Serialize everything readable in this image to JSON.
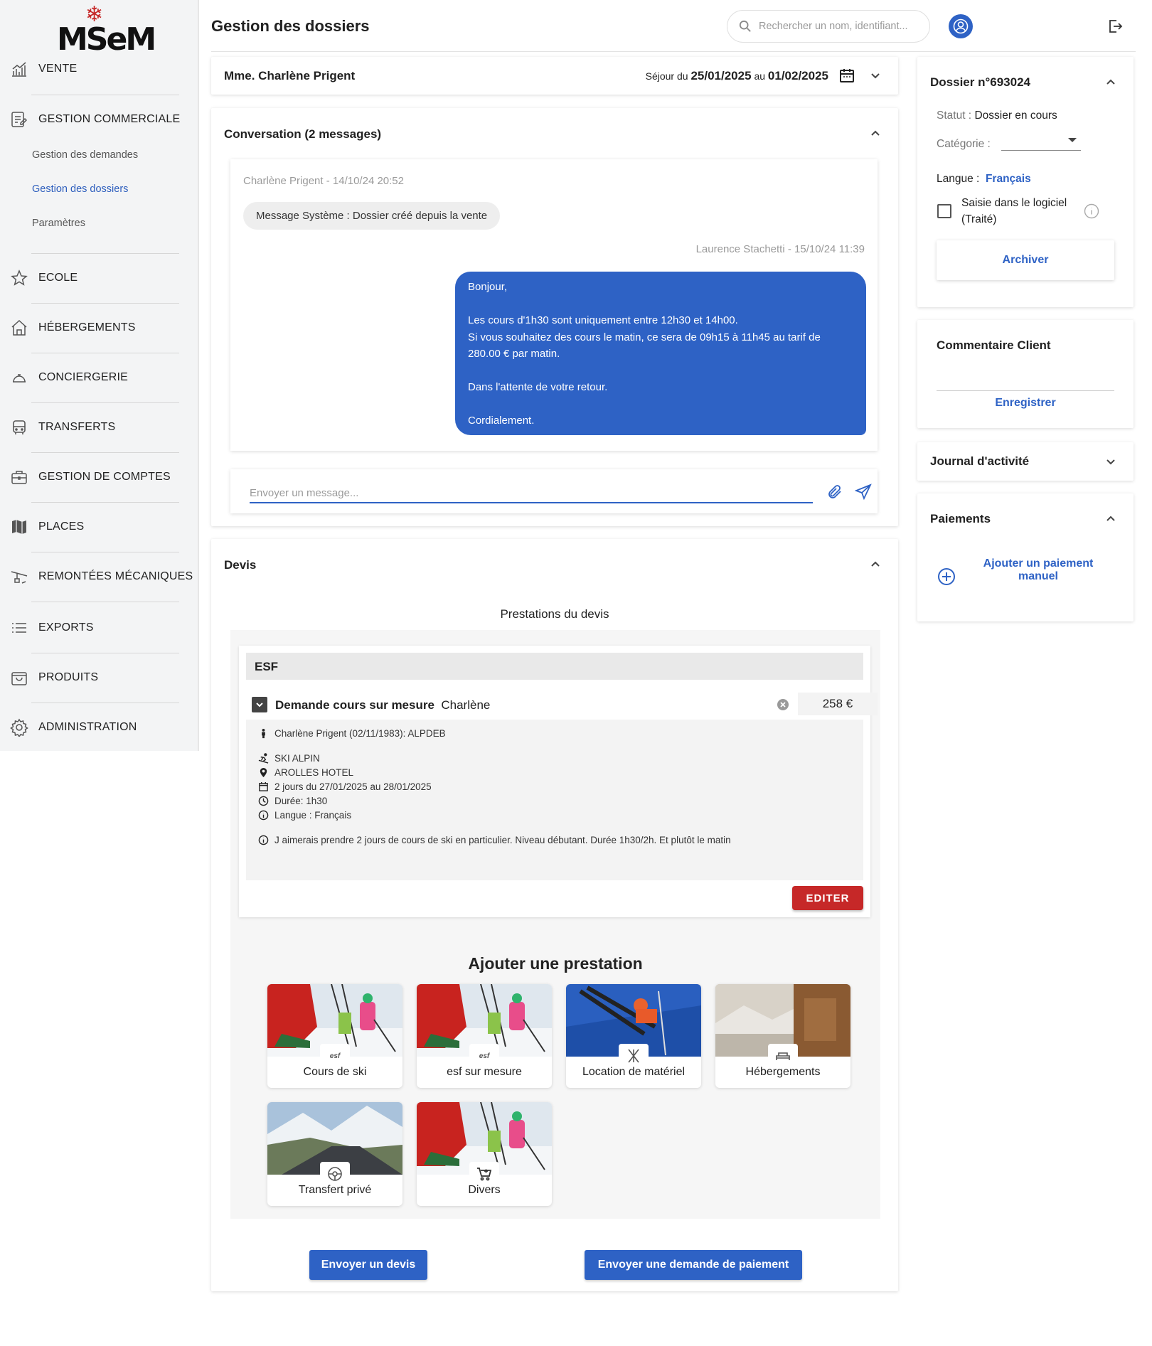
{
  "app": {
    "logo_text": "MSeM"
  },
  "header": {
    "title": "Gestion des dossiers",
    "search_placeholder": "Rechercher un nom, identifiant..."
  },
  "sidebar": {
    "items": [
      {
        "label": "VENTE",
        "icon": "chart-icon"
      },
      {
        "label": "GESTION COMMERCIALE",
        "icon": "document-edit-icon"
      },
      {
        "label": "ECOLE",
        "icon": "star-icon"
      },
      {
        "label": "HÉBERGEMENTS",
        "icon": "house-icon"
      },
      {
        "label": "CONCIERGERIE",
        "icon": "cloche-icon"
      },
      {
        "label": "TRANSFERTS",
        "icon": "bus-icon"
      },
      {
        "label": "GESTION DE COMPTES",
        "icon": "briefcase-icon"
      },
      {
        "label": "PLACES",
        "icon": "map-icon"
      },
      {
        "label": "REMONTÉES MÉCANIQUES",
        "icon": "ski-lift-icon"
      },
      {
        "label": "EXPORTS",
        "icon": "list-icon"
      },
      {
        "label": "PRODUITS",
        "icon": "bag-icon"
      },
      {
        "label": "ADMINISTRATION",
        "icon": "gear-icon"
      }
    ],
    "subitems": [
      {
        "label": "Gestion des demandes"
      },
      {
        "label": "Gestion des dossiers",
        "active": true
      },
      {
        "label": "Paramètres"
      }
    ]
  },
  "client": {
    "name": "Mme. Charlène Prigent",
    "sejour_prefix": "Séjour du",
    "date_from": "25/01/2025",
    "au": "au",
    "date_to": "01/02/2025"
  },
  "conversation": {
    "title": "Conversation (2 messages)",
    "messages": [
      {
        "meta": "Charlène Prigent - 14/10/24 20:52",
        "text": "Message Système : Dossier créé depuis la vente"
      },
      {
        "meta": "Laurence Stachetti - 15/10/24 11:39",
        "text": "Bonjour,\n\nLes cours d'1h30 sont uniquement entre 12h30 et 14h00.\nSi vous souhaitez des cours le matin, ce sera de 09h15 à 11h45 au tarif de 280.00 € par matin.\n\nDans l'attente de votre retour.\n\nCordialement."
      }
    ],
    "compose_placeholder": "Envoyer un message..."
  },
  "devis": {
    "title": "Devis",
    "prestations_title": "Prestations du devis",
    "provider": "ESF",
    "line": {
      "title": "Demande cours sur mesure",
      "person": "Charlène",
      "price": "258 €",
      "details": [
        {
          "icon": "person-icon",
          "text": "Charlène Prigent (02/11/1983): ALPDEB"
        },
        {
          "icon": "skier-icon",
          "text": "SKI ALPIN"
        },
        {
          "icon": "pin-icon",
          "text": "AROLLES HOTEL"
        },
        {
          "icon": "calendar-icon",
          "text": "2 jours du 27/01/2025 au 28/01/2025"
        },
        {
          "icon": "clock-icon",
          "text": "Durée: 1h30"
        },
        {
          "icon": "info-icon",
          "text": "Langue : Français"
        },
        {
          "icon": "info-icon",
          "text": "J aimerais prendre 2 jours de cours de ski en particulier. Niveau débutant. Durée 1h30/2h. Et plutôt le matin"
        }
      ],
      "edit_label": "EDITER"
    },
    "add_title": "Ajouter une prestation",
    "tiles": [
      {
        "label": "Cours de ski",
        "badge": "esf"
      },
      {
        "label": "esf sur mesure",
        "badge": "esf"
      },
      {
        "label": "Location de matériel",
        "badge": "ski-rental-icon"
      },
      {
        "label": "Hébergements",
        "badge": "bed-icon"
      },
      {
        "label": "Transfert privé",
        "badge": "steering-wheel-icon"
      },
      {
        "label": "Divers",
        "badge": "cart-icon"
      }
    ],
    "send_devis_label": "Envoyer un devis",
    "send_payment_label": "Envoyer une demande de paiement"
  },
  "dossier": {
    "title": "Dossier n°693024",
    "statut_label": "Statut :",
    "statut_value": "Dossier en cours",
    "categorie_label": "Catégorie :",
    "langue_label": "Langue :",
    "langue_value": "Français",
    "saisie_label": "Saisie dans le logiciel (Traité)",
    "archive_label": "Archiver"
  },
  "comment": {
    "title": "Commentaire Client",
    "save_label": "Enregistrer"
  },
  "journal": {
    "title": "Journal d'activité"
  },
  "paiements": {
    "title": "Paiements",
    "add_label": "Ajouter un paiement manuel"
  },
  "colors": {
    "primary": "#2e62c5",
    "danger": "#c62828",
    "sidebar_bg": "#f3f4f5"
  }
}
